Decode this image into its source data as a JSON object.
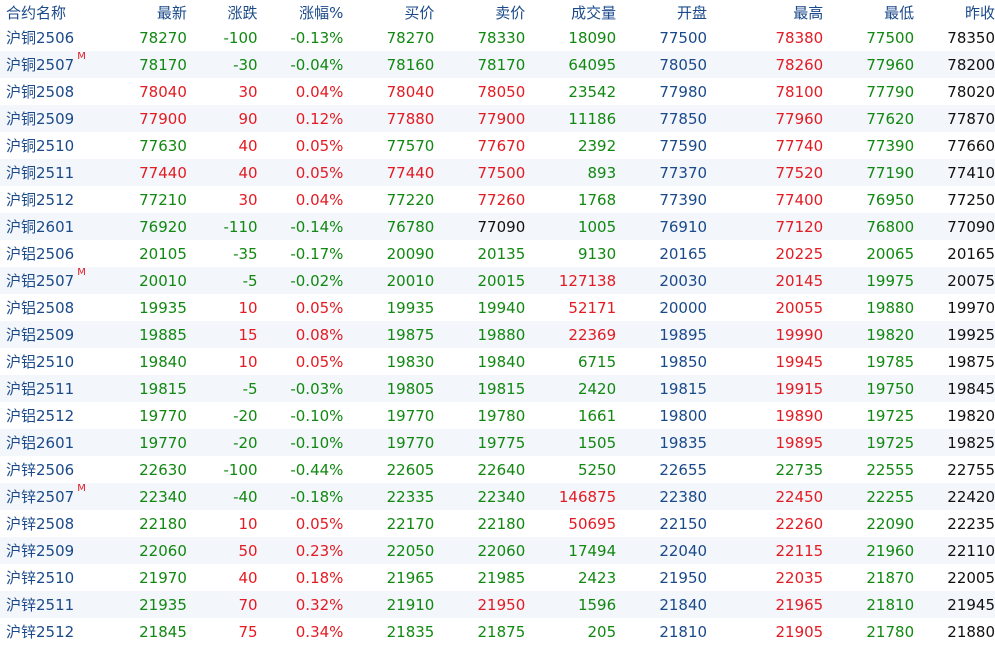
{
  "colors": {
    "up": "#e31b23",
    "down": "#118811",
    "flat": "#111111",
    "header": "#1b4a8a"
  },
  "headers": [
    "合约名称",
    "最新",
    "涨跌",
    "涨幅%",
    "买价",
    "卖价",
    "成交量",
    "开盘",
    "最高",
    "最低",
    "昨收"
  ],
  "rows": [
    [
      "沪铜2506",
      "",
      "78270",
      "-100",
      "-0.13%",
      "78270",
      "78330",
      "18090",
      "77500",
      "78380",
      "77500",
      "78350"
    ],
    [
      "沪铜2507",
      "M",
      "78170",
      "-30",
      "-0.04%",
      "78160",
      "78170",
      "64095",
      "78050",
      "78260",
      "77960",
      "78200"
    ],
    [
      "沪铜2508",
      "",
      "78040",
      "30",
      "0.04%",
      "78040",
      "78050",
      "23542",
      "77980",
      "78100",
      "77790",
      "78020"
    ],
    [
      "沪铜2509",
      "",
      "77900",
      "90",
      "0.12%",
      "77880",
      "77900",
      "11186",
      "77850",
      "77960",
      "77620",
      "77870"
    ],
    [
      "沪铜2510",
      "",
      "77630",
      "40",
      "0.05%",
      "77570",
      "77670",
      "2392",
      "77590",
      "77740",
      "77390",
      "77660"
    ],
    [
      "沪铜2511",
      "",
      "77440",
      "40",
      "0.05%",
      "77440",
      "77500",
      "893",
      "77370",
      "77520",
      "77190",
      "77410"
    ],
    [
      "沪铜2512",
      "",
      "77210",
      "30",
      "0.04%",
      "77220",
      "77260",
      "1768",
      "77390",
      "77400",
      "76950",
      "77250"
    ],
    [
      "沪铜2601",
      "",
      "76920",
      "-110",
      "-0.14%",
      "76780",
      "77090",
      "1005",
      "76910",
      "77120",
      "76800",
      "77090"
    ],
    [
      "沪铝2506",
      "",
      "20105",
      "-35",
      "-0.17%",
      "20090",
      "20135",
      "9130",
      "20165",
      "20225",
      "20065",
      "20165"
    ],
    [
      "沪铝2507",
      "M",
      "20010",
      "-5",
      "-0.02%",
      "20010",
      "20015",
      "127138",
      "20030",
      "20145",
      "19975",
      "20075"
    ],
    [
      "沪铝2508",
      "",
      "19935",
      "10",
      "0.05%",
      "19935",
      "19940",
      "52171",
      "20000",
      "20055",
      "19880",
      "19970"
    ],
    [
      "沪铝2509",
      "",
      "19885",
      "15",
      "0.08%",
      "19875",
      "19880",
      "22369",
      "19895",
      "19990",
      "19820",
      "19925"
    ],
    [
      "沪铝2510",
      "",
      "19840",
      "10",
      "0.05%",
      "19830",
      "19840",
      "6715",
      "19850",
      "19945",
      "19785",
      "19875"
    ],
    [
      "沪铝2511",
      "",
      "19815",
      "-5",
      "-0.03%",
      "19805",
      "19815",
      "2420",
      "19815",
      "19915",
      "19750",
      "19845"
    ],
    [
      "沪铝2512",
      "",
      "19770",
      "-20",
      "-0.10%",
      "19770",
      "19780",
      "1661",
      "19800",
      "19890",
      "19725",
      "19820"
    ],
    [
      "沪铝2601",
      "",
      "19770",
      "-20",
      "-0.10%",
      "19770",
      "19775",
      "1505",
      "19835",
      "19895",
      "19725",
      "19825"
    ],
    [
      "沪锌2506",
      "",
      "22630",
      "-100",
      "-0.44%",
      "22605",
      "22640",
      "5250",
      "22655",
      "22735",
      "22555",
      "22755"
    ],
    [
      "沪锌2507",
      "M",
      "22340",
      "-40",
      "-0.18%",
      "22335",
      "22340",
      "146875",
      "22380",
      "22450",
      "22255",
      "22420"
    ],
    [
      "沪锌2508",
      "",
      "22180",
      "10",
      "0.05%",
      "22170",
      "22180",
      "50695",
      "22150",
      "22260",
      "22090",
      "22235"
    ],
    [
      "沪锌2509",
      "",
      "22060",
      "50",
      "0.23%",
      "22050",
      "22060",
      "17494",
      "22040",
      "22115",
      "21960",
      "22110"
    ],
    [
      "沪锌2510",
      "",
      "21970",
      "40",
      "0.18%",
      "21965",
      "21985",
      "2423",
      "21950",
      "22035",
      "21870",
      "22005"
    ],
    [
      "沪锌2511",
      "",
      "21935",
      "70",
      "0.32%",
      "21910",
      "21950",
      "1596",
      "21840",
      "21965",
      "21810",
      "21945"
    ],
    [
      "沪锌2512",
      "",
      "21845",
      "75",
      "0.34%",
      "21835",
      "21875",
      "205",
      "21810",
      "21905",
      "21780",
      "21880"
    ]
  ]
}
